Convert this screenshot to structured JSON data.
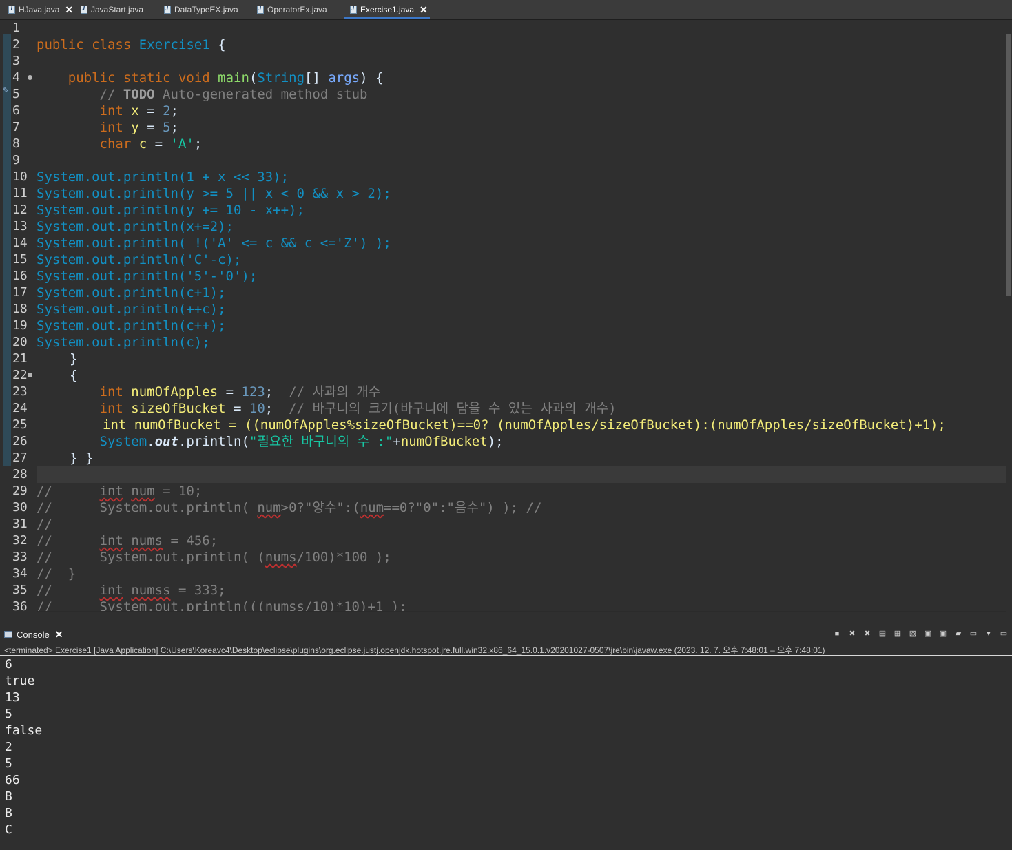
{
  "tabs": [
    {
      "label": "HJava.java",
      "closable": true,
      "active": false
    },
    {
      "label": "JavaStart.java",
      "closable": false,
      "active": false
    },
    {
      "label": "DataTypeEX.java",
      "closable": false,
      "active": false
    },
    {
      "label": "OperatorEx.java",
      "closable": false,
      "active": false
    },
    {
      "label": "Exercise1.java",
      "closable": true,
      "active": true
    }
  ],
  "editor": {
    "line_numbers": [
      "1",
      "2",
      "3",
      "4",
      "5",
      "6",
      "7",
      "8",
      "9",
      "10",
      "11",
      "12",
      "13",
      "14",
      "15",
      "16",
      "17",
      "18",
      "19",
      "20",
      "21",
      "22",
      "23",
      "24",
      "25",
      "26",
      "27",
      "28",
      "29",
      "30",
      "31",
      "32",
      "33",
      "34",
      "35",
      "36"
    ],
    "code": {
      "class_decl": [
        "public",
        "class",
        "Exercise1",
        "{"
      ],
      "main_decl": [
        "public",
        "static",
        "void",
        "main",
        "(",
        "String",
        "[] ",
        "args",
        ") {"
      ],
      "todo_comment": [
        "// ",
        "TODO",
        " Auto-generated method stub"
      ],
      "l6": [
        "int",
        "x",
        "2"
      ],
      "l7": [
        "int",
        "y",
        "5"
      ],
      "l8": [
        "char",
        "c",
        "'A'"
      ],
      "l10": "System.out.println(1 + x << 33);",
      "l11": "System.out.println(y >= 5 || x < 0 && x > 2);",
      "l12": "System.out.println(y += 10 - x++);",
      "l13": "System.out.println(x+=2);",
      "l14": "System.out.println( !('A' <= c && c <='Z') );",
      "l15": "System.out.println('C'-c);",
      "l16": "System.out.println('5'-'0');",
      "l17": "System.out.println(c+1);",
      "l18": "System.out.println(++c);",
      "l19": "System.out.println(c++);",
      "l20": "System.out.println(c);",
      "l21": "}",
      "l22": "{",
      "l23": [
        "int",
        "numOfApples",
        "123",
        "// 사과의 개수"
      ],
      "l24": [
        "int",
        "sizeOfBucket",
        "10",
        "// 바구니의 크기(바구니에 담을 수 있는 사과의 개수)"
      ],
      "l25": "int numOfBucket = ((numOfApples%sizeOfBucket)==0? (numOfApples/sizeOfBucket):(numOfApples/sizeOfBucket)+1);",
      "l26": [
        "System",
        "out",
        "println",
        "\"필요한 바구니의 수 :\"",
        "numOfBucket"
      ],
      "l27": "} }",
      "l29": [
        "//",
        "int",
        "num",
        " = 10;"
      ],
      "l30": [
        "//",
        "System.out.println( ",
        "num",
        ">0?\"양수\":(",
        "num",
        "==0?\"0\":\"음수\") ); //"
      ],
      "l31": "//",
      "l32": [
        "//",
        "int",
        "nums",
        " = 456;"
      ],
      "l33": [
        "//",
        "System.out.println( (",
        "nums",
        "/100)*100 );"
      ],
      "l34": "//  }",
      "l35": [
        "//",
        "int",
        "numss",
        " = 333;"
      ],
      "l36": "//      System.out.println(((numss/10)*10)+1 );"
    }
  },
  "console": {
    "tab_label": "Console",
    "status": "<terminated> Exercise1 [Java Application] C:\\Users\\Koreavc4\\Desktop\\eclipse\\plugins\\org.eclipse.justj.openjdk.hotspot.jre.full.win32.x86_64_15.0.1.v20201027-0507\\jre\\bin\\javaw.exe  (2023. 12. 7. 오후 7:48:01 – 오후 7:48:01)",
    "output": [
      "6",
      "true",
      "13",
      "5",
      "false",
      "2",
      "5",
      "66",
      "B",
      "B",
      "C"
    ],
    "toolbar_icons": [
      "terminate-icon",
      "remove-launch-icon",
      "remove-all-icon",
      "clear-console-icon",
      "scroll-lock-icon",
      "word-wrap-icon",
      "pin-console-icon",
      "show-on-stdout-icon",
      "show-on-stderr-icon",
      "open-console-icon",
      "display-selected-console-icon",
      "view-menu-icon",
      "minimize-icon"
    ]
  },
  "colors": {
    "keyword": "#cc6c1d",
    "type": "#1290c3",
    "method": "#8dda6a",
    "variable": "#f3ec79",
    "number": "#6897bb",
    "string": "#17c6a3",
    "comment": "#808080",
    "active_tab_underline": "#3c77c7"
  }
}
